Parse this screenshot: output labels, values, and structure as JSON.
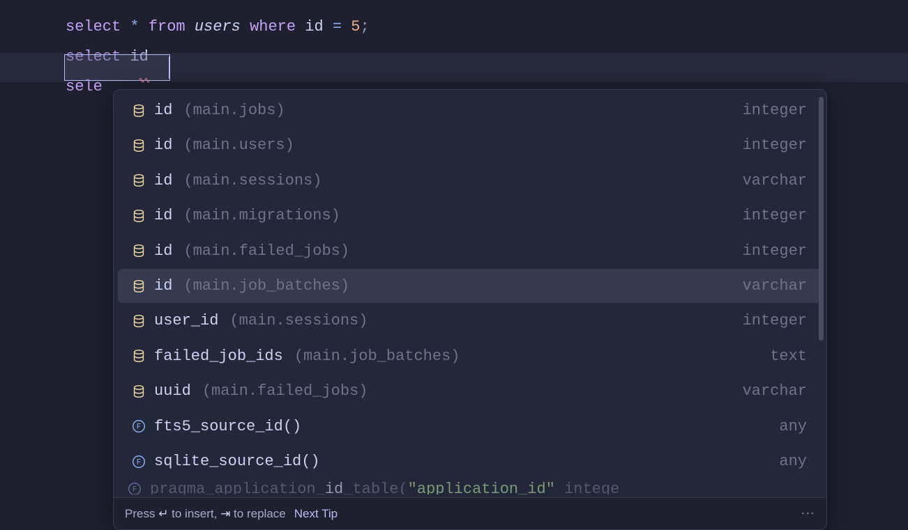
{
  "editor": {
    "line1": {
      "select": "select",
      "star": "*",
      "from": "from",
      "table": "users",
      "where": "where",
      "col": "id",
      "eq": "=",
      "val": "5",
      "semi": ";"
    },
    "line2": {
      "select": "select",
      "typed": "id"
    },
    "line3": {
      "select": "sele"
    }
  },
  "completions": [
    {
      "name": "id",
      "context": "(main.jobs)",
      "type": "integer",
      "kind": "column",
      "selected": false
    },
    {
      "name": "id",
      "context": "(main.users)",
      "type": "integer",
      "kind": "column",
      "selected": false
    },
    {
      "name": "id",
      "context": "(main.sessions)",
      "type": "varchar",
      "kind": "column",
      "selected": false
    },
    {
      "name": "id",
      "context": "(main.migrations)",
      "type": "integer",
      "kind": "column",
      "selected": false
    },
    {
      "name": "id",
      "context": "(main.failed_jobs)",
      "type": "integer",
      "kind": "column",
      "selected": false
    },
    {
      "name": "id",
      "context": "(main.job_batches)",
      "type": "varchar",
      "kind": "column",
      "selected": true
    },
    {
      "name": "user_id",
      "context": "(main.sessions)",
      "type": "integer",
      "kind": "column",
      "selected": false
    },
    {
      "name": "failed_job_ids",
      "context": "(main.job_batches)",
      "type": "text",
      "kind": "column",
      "selected": false
    },
    {
      "name": "uuid",
      "context": "(main.failed_jobs)",
      "type": "varchar",
      "kind": "column",
      "selected": false
    },
    {
      "name": "fts5_source_id()",
      "context": "",
      "type": "any",
      "kind": "function",
      "selected": false
    },
    {
      "name": "sqlite_source_id()",
      "context": "",
      "type": "any",
      "kind": "function",
      "selected": false
    }
  ],
  "partial": {
    "pre": "pragma_application_",
    "hl": "id",
    "mid": "_table(",
    "str": "\"application_id\"",
    "post": " intege"
  },
  "footer": {
    "press": "Press ",
    "insert_key": "↵",
    "insert_text": " to insert, ",
    "replace_key": "⇥",
    "replace_text": " to replace",
    "next_tip": "Next Tip",
    "menu": "⋮"
  }
}
